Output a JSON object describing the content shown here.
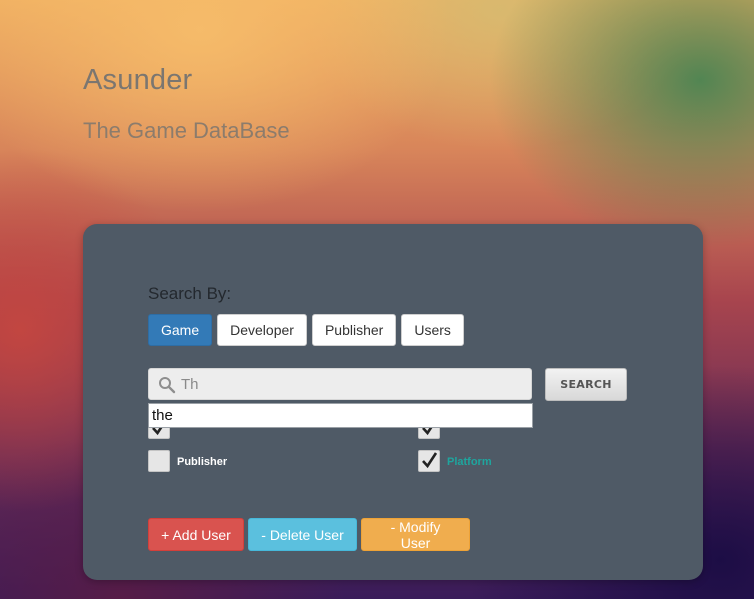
{
  "header": {
    "title": "Asunder",
    "subtitle": "The Game DataBase"
  },
  "search": {
    "label": "Search By:",
    "tabs": [
      {
        "label": "Game",
        "active": true
      },
      {
        "label": "Developer",
        "active": false
      },
      {
        "label": "Publisher",
        "active": false
      },
      {
        "label": "Users",
        "active": false
      }
    ],
    "input_value": "Th",
    "button_label": "SEARCH",
    "suggestion": "the"
  },
  "filters": [
    {
      "label": "",
      "checked": true
    },
    {
      "label": "",
      "checked": true
    },
    {
      "label": "Publisher",
      "checked": false,
      "color": "#ffffff"
    },
    {
      "label": "Platform",
      "checked": true,
      "color": "#1fa59e"
    }
  ],
  "actions": {
    "add_user": "+ Add User",
    "delete_user": "- Delete User",
    "modify_user": "- Modify User"
  },
  "colors": {
    "accent": "#337ab7",
    "danger": "#d9534f",
    "info": "#5bc0de",
    "warning": "#f0ad4e",
    "panel": "#4f5a66",
    "teal_label": "#1fa59e"
  }
}
